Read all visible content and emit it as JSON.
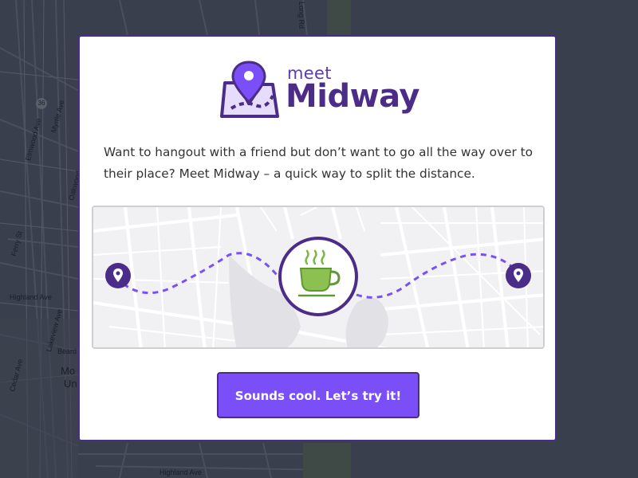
{
  "background_map": {
    "labels": [
      "Mo",
      "Un",
      "Beard",
      "Cedar Ave",
      "Highland Ave",
      "Highland Ave",
      "Ferry St",
      "Long Rd",
      "Myrtle Ave",
      "Oakwood",
      "Elmwood Ave",
      "Lakeview Ave"
    ],
    "route_shield": "36"
  },
  "modal": {
    "logo": {
      "small_text": "meet",
      "big_text": "Midway"
    },
    "intro_text": "Want to hangout with a friend but don’t want to go all the way over to their place? Meet Midway – a quick way to split the distance.",
    "cta_label": "Sounds cool. Let’s try it!"
  },
  "colors": {
    "brand_purple": "#4b2c89",
    "accent_purple": "#7b4ff7",
    "coffee_green": "#7ab648",
    "page_bg": "#3a3f4d"
  },
  "icons": {
    "logo": "map-pin-route-icon",
    "start_pin": "location-pin-icon",
    "end_pin": "location-pin-icon",
    "meeting_point": "coffee-cup-icon"
  }
}
